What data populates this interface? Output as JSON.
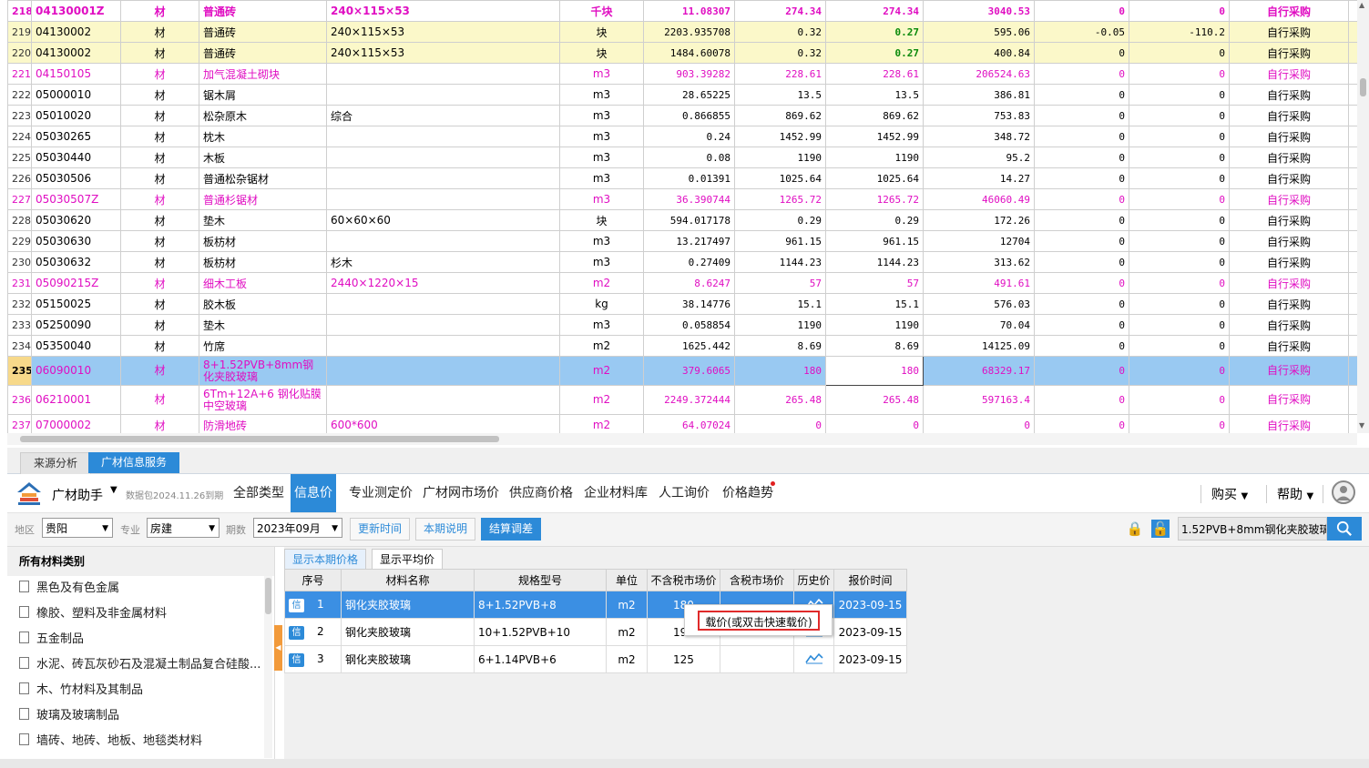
{
  "grid": {
    "rows": [
      {
        "no": "218",
        "code": "04130001Z",
        "type": "材",
        "name": "普通砖",
        "spec": "240×115×53",
        "unit": "千块",
        "qty": "11.08307",
        "price": "274.34",
        "taxprice": "274.34",
        "amount": "3040.53",
        "d1": "0",
        "d2": "0",
        "source": "自行采购",
        "style": "pink bold"
      },
      {
        "no": "219",
        "code": "04130002",
        "type": "材",
        "name": "普通砖",
        "spec": "240×115×53",
        "unit": "块",
        "qty": "2203.935708",
        "price": "0.32",
        "taxprice": "0.27",
        "amount": "595.06",
        "d1": "-0.05",
        "d2": "-110.2",
        "source": "自行采购",
        "style": "yellow",
        "green": true
      },
      {
        "no": "220",
        "code": "04130002",
        "type": "材",
        "name": "普通砖",
        "spec": "240×115×53",
        "unit": "块",
        "qty": "1484.60078",
        "price": "0.32",
        "taxprice": "0.27",
        "amount": "400.84",
        "d1": "0",
        "d2": "0",
        "source": "自行采购",
        "style": "yellow",
        "green": true
      },
      {
        "no": "221",
        "code": "04150105",
        "type": "材",
        "name": "加气混凝土砌块",
        "spec": "",
        "unit": "m3",
        "qty": "903.39282",
        "price": "228.61",
        "taxprice": "228.61",
        "amount": "206524.63",
        "d1": "0",
        "d2": "0",
        "source": "自行采购",
        "style": "pink"
      },
      {
        "no": "222",
        "code": "05000010",
        "type": "材",
        "name": "锯木屑",
        "spec": "",
        "unit": "m3",
        "qty": "28.65225",
        "price": "13.5",
        "taxprice": "13.5",
        "amount": "386.81",
        "d1": "0",
        "d2": "0",
        "source": "自行采购",
        "style": ""
      },
      {
        "no": "223",
        "code": "05010020",
        "type": "材",
        "name": "松杂原木",
        "spec": "综合",
        "unit": "m3",
        "qty": "0.866855",
        "price": "869.62",
        "taxprice": "869.62",
        "amount": "753.83",
        "d1": "0",
        "d2": "0",
        "source": "自行采购",
        "style": ""
      },
      {
        "no": "224",
        "code": "05030265",
        "type": "材",
        "name": "枕木",
        "spec": "",
        "unit": "m3",
        "qty": "0.24",
        "price": "1452.99",
        "taxprice": "1452.99",
        "amount": "348.72",
        "d1": "0",
        "d2": "0",
        "source": "自行采购",
        "style": ""
      },
      {
        "no": "225",
        "code": "05030440",
        "type": "材",
        "name": "木板",
        "spec": "",
        "unit": "m3",
        "qty": "0.08",
        "price": "1190",
        "taxprice": "1190",
        "amount": "95.2",
        "d1": "0",
        "d2": "0",
        "source": "自行采购",
        "style": ""
      },
      {
        "no": "226",
        "code": "05030506",
        "type": "材",
        "name": "普通松杂锯材",
        "spec": "",
        "unit": "m3",
        "qty": "0.01391",
        "price": "1025.64",
        "taxprice": "1025.64",
        "amount": "14.27",
        "d1": "0",
        "d2": "0",
        "source": "自行采购",
        "style": ""
      },
      {
        "no": "227",
        "code": "05030507Z",
        "type": "材",
        "name": "普通杉锯材",
        "spec": "",
        "unit": "m3",
        "qty": "36.390744",
        "price": "1265.72",
        "taxprice": "1265.72",
        "amount": "46060.49",
        "d1": "0",
        "d2": "0",
        "source": "自行采购",
        "style": "pink"
      },
      {
        "no": "228",
        "code": "05030620",
        "type": "材",
        "name": "垫木",
        "spec": "60×60×60",
        "unit": "块",
        "qty": "594.017178",
        "price": "0.29",
        "taxprice": "0.29",
        "amount": "172.26",
        "d1": "0",
        "d2": "0",
        "source": "自行采购",
        "style": ""
      },
      {
        "no": "229",
        "code": "05030630",
        "type": "材",
        "name": "板枋材",
        "spec": "",
        "unit": "m3",
        "qty": "13.217497",
        "price": "961.15",
        "taxprice": "961.15",
        "amount": "12704",
        "d1": "0",
        "d2": "0",
        "source": "自行采购",
        "style": ""
      },
      {
        "no": "230",
        "code": "05030632",
        "type": "材",
        "name": "板枋材",
        "spec": "杉木",
        "unit": "m3",
        "qty": "0.27409",
        "price": "1144.23",
        "taxprice": "1144.23",
        "amount": "313.62",
        "d1": "0",
        "d2": "0",
        "source": "自行采购",
        "style": ""
      },
      {
        "no": "231",
        "code": "05090215Z",
        "type": "材",
        "name": "细木工板",
        "spec": "2440×1220×15",
        "unit": "m2",
        "qty": "8.6247",
        "price": "57",
        "taxprice": "57",
        "amount": "491.61",
        "d1": "0",
        "d2": "0",
        "source": "自行采购",
        "style": "pink"
      },
      {
        "no": "232",
        "code": "05150025",
        "type": "材",
        "name": "胶木板",
        "spec": "",
        "unit": "kg",
        "qty": "38.14776",
        "price": "15.1",
        "taxprice": "15.1",
        "amount": "576.03",
        "d1": "0",
        "d2": "0",
        "source": "自行采购",
        "style": ""
      },
      {
        "no": "233",
        "code": "05250090",
        "type": "材",
        "name": "垫木",
        "spec": "",
        "unit": "m3",
        "qty": "0.058854",
        "price": "1190",
        "taxprice": "1190",
        "amount": "70.04",
        "d1": "0",
        "d2": "0",
        "source": "自行采购",
        "style": ""
      },
      {
        "no": "234",
        "code": "05350040",
        "type": "材",
        "name": "竹席",
        "spec": "",
        "unit": "m2",
        "qty": "1625.442",
        "price": "8.69",
        "taxprice": "8.69",
        "amount": "14125.09",
        "d1": "0",
        "d2": "0",
        "source": "自行采购",
        "style": ""
      },
      {
        "no": "235",
        "code": "06090010",
        "type": "材",
        "name": "8+1.52PVB+8mm钢化夹胶玻璃",
        "spec": "",
        "unit": "m2",
        "qty": "379.6065",
        "price": "180",
        "taxprice": "180",
        "amount": "68329.17",
        "d1": "0",
        "d2": "0",
        "source": "自行采购",
        "style": "pink selected tall",
        "edit": true
      },
      {
        "no": "236",
        "code": "06210001",
        "type": "材",
        "name": "6Tm+12A+6 钢化贴膜中空玻璃",
        "spec": "",
        "unit": "m2",
        "qty": "2249.372444",
        "price": "265.48",
        "taxprice": "265.48",
        "amount": "597163.4",
        "d1": "0",
        "d2": "0",
        "source": "自行采购",
        "style": "pink tall"
      },
      {
        "no": "237",
        "code": "07000002",
        "type": "材",
        "name": "防滑地砖",
        "spec": "600*600",
        "unit": "m2",
        "qty": "64.07024",
        "price": "0",
        "taxprice": "0",
        "amount": "0",
        "d1": "0",
        "d2": "0",
        "source": "自行采购",
        "style": "pink"
      }
    ]
  },
  "bottom_tabs": {
    "source_analysis": "来源分析",
    "gc_info": "广材信息服务"
  },
  "toolbar": {
    "app_name": "广材助手",
    "package": "数据包2024.11.26到期",
    "nav": [
      "全部类型",
      "信息价",
      "专业测定价",
      "广材网市场价",
      "供应商价格",
      "企业材料库",
      "人工询价",
      "价格趋势"
    ],
    "active_nav": "信息价",
    "buy": "购买",
    "help": "帮助"
  },
  "filter": {
    "region_label": "地区",
    "region": "贵阳",
    "major_label": "专业",
    "major": "房建",
    "period_label": "期数",
    "period": "2023年09月",
    "update_time": "更新时间",
    "period_note": "本期说明",
    "settle": "结算调差",
    "search_value": "1.52PVB+8mm钢化夹胶玻璃"
  },
  "categories": {
    "header": "所有材料类别",
    "items": [
      "黑色及有色金属",
      "橡胶、塑料及非金属材料",
      "五金制品",
      "水泥、砖瓦灰砂石及混凝土制品复合硅酸...",
      "木、竹材料及其制品",
      "玻璃及玻璃制品",
      "墙砖、地砖、地板、地毯类材料"
    ]
  },
  "results": {
    "tab_current": "显示本期价格",
    "tab_avg": "显示平均价",
    "headers": [
      "序号",
      "材料名称",
      "规格型号",
      "单位",
      "不含税市场价",
      "含税市场价",
      "历史价",
      "报价时间"
    ],
    "badge": "信",
    "rows": [
      {
        "no": "1",
        "name": "钢化夹胶玻璃",
        "spec": "8+1.52PVB+8",
        "unit": "m2",
        "price": "180",
        "taxprice": "",
        "date": "2023-09-15"
      },
      {
        "no": "2",
        "name": "钢化夹胶玻璃",
        "spec": "10+1.52PVB+10",
        "unit": "m2",
        "price": "19",
        "taxprice": "",
        "date": "2023-09-15"
      },
      {
        "no": "3",
        "name": "钢化夹胶玻璃",
        "spec": "6+1.14PVB+6",
        "unit": "m2",
        "price": "125",
        "taxprice": "",
        "date": "2023-09-15"
      }
    ]
  },
  "context_menu": {
    "item": "载价(或双击快速载价)"
  }
}
